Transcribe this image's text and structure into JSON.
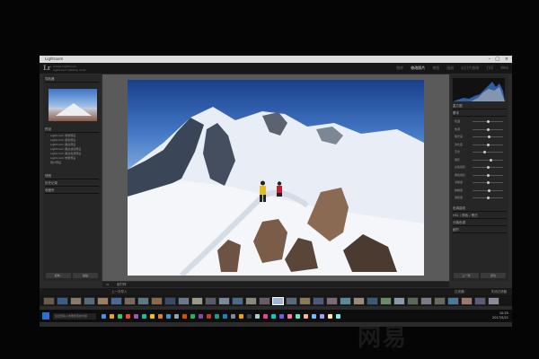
{
  "window": {
    "title": "Lightroom",
    "controls": [
      "–",
      "□",
      "×"
    ]
  },
  "identity": {
    "logo": "Lr",
    "catalog_line1": "Adobe Lightroom",
    "catalog_line2": "Lightroom Catalog .lrcat"
  },
  "modules": [
    {
      "label": "图库",
      "active": false
    },
    {
      "label": "修改照片",
      "active": true
    },
    {
      "label": "地图",
      "active": false
    },
    {
      "label": "画册",
      "active": false
    },
    {
      "label": "幻灯片放映",
      "active": false
    },
    {
      "label": "打印",
      "active": false
    },
    {
      "label": "Web",
      "active": false
    }
  ],
  "left_panel": {
    "navigator_header": "导航器",
    "presets_header": "预设",
    "presets": [
      "Lightroom 常规预设",
      "Lightroom 颜色预设",
      "Lightroom 黑白预设",
      "Lightroom 黑白滤镜预设",
      "Lightroom 黑白色调预设",
      "Lightroom 效果预设",
      "用户预设"
    ],
    "snapshots_header": "快照",
    "history_header": "历史记录",
    "collections_header": "收藏夹",
    "copy_button": "复制...",
    "paste_button": "粘贴"
  },
  "right_panel": {
    "histogram_header": "直方图",
    "basic_header": "基本",
    "sliders": [
      {
        "label": "色温",
        "value": 0.5
      },
      {
        "label": "色调",
        "value": 0.5
      },
      {
        "label": "曝光度",
        "value": 0.55
      },
      {
        "label": "对比度",
        "value": 0.5
      },
      {
        "label": "高光",
        "value": 0.4
      },
      {
        "label": "阴影",
        "value": 0.6
      },
      {
        "label": "白色色阶",
        "value": 0.5
      },
      {
        "label": "黑色色阶",
        "value": 0.5
      },
      {
        "label": "清晰度",
        "value": 0.5
      },
      {
        "label": "鲜艳度",
        "value": 0.55
      },
      {
        "label": "饱和度",
        "value": 0.5
      }
    ],
    "tone_curve_header": "色调曲线",
    "hsl_header": "HSL / 颜色 / 黑白",
    "split_header": "分离色调",
    "detail_header": "细节",
    "previous_button": "上一张",
    "reset_button": "复位"
  },
  "toolbar": {
    "view_label": "▭",
    "softproof_label": "软打样"
  },
  "filmstrip_bar": {
    "source": "上一次导入",
    "filter": "过滤器：",
    "filter_value": "关闭过滤器"
  },
  "filmstrip_colors": [
    "#6a5a4a",
    "#3e5c8a",
    "#8a7a6a",
    "#556b7a",
    "#9a8060",
    "#4a6a9a",
    "#7a6a5a",
    "#5a7a8a",
    "#8a6a4a",
    "#3a4a6a",
    "#6a7a8a",
    "#9a9a8a",
    "#5a5a6a",
    "#7a8a9a",
    "#4a6a8a",
    "#8a8a7a",
    "#6a5a6a",
    "#a0b8d0",
    "#5a6a7a",
    "#8a7a5a",
    "#4a5a7a",
    "#7a6a7a",
    "#5a8a9a",
    "#9a8a7a",
    "#3a5a7a",
    "#6a8a6a",
    "#8a9aaa",
    "#5a6a5a",
    "#7a7a8a",
    "#6a6a5a",
    "#4a7a9a",
    "#9a7a6a",
    "#5a5a7a",
    "#8a8a9a",
    "#6a7a6a",
    "#7a5a5a",
    "#4a6a7a",
    "#8a6a7a",
    "#5a7a6a",
    "#9a9aaa",
    "#6a5a7a",
    "#7a8a7a",
    "#4a5a6a",
    "#8a7a8a",
    "#5a8a7a",
    "#9a8a9a",
    "#6a7a9a",
    "#7a6a8a",
    "#4a8a8a",
    "#8a5a6a",
    "#5a6a8a",
    "#9a7a8a",
    "#6a8a9a",
    "#7a9a8a",
    "#4a6a6a",
    "#8a9a8a",
    "#5a9a9a",
    "#9a6a7a",
    "#6a6a8a",
    "#7a7a9a",
    "#4a7a8a",
    "#8a8a8a",
    "#5a6a9a",
    "#9a8a8a",
    "#6a9a8a",
    "#7a8a8a",
    "#4a5a8a",
    "#8a7a9a",
    "#5a7a9a",
    "#9a9a9a",
    "#6a6a9a",
    "#7a9a9a",
    "#4a8a9a",
    "#8a6a8a",
    "#5a8a8a",
    "#9a7a9a",
    "#6a8a8a",
    "#7a7a7a",
    "#4a9a9a",
    "#8a8a9a"
  ],
  "selected_thumb": 17,
  "taskbar": {
    "search_placeholder": "在这里输入你要搜索的内容",
    "icon_colors": [
      "#4a90e2",
      "#f0a030",
      "#2ecc71",
      "#e74c3c",
      "#9b59b6",
      "#1abc9c",
      "#f1c40f",
      "#e67e22",
      "#3498db",
      "#95a5a6",
      "#d35400",
      "#27ae60",
      "#8e44ad",
      "#c0392b",
      "#16a085",
      "#2980b9",
      "#7f8c8d",
      "#f39c12",
      "#2c3e50",
      "#bdc3c7",
      "#e84393",
      "#00cec9",
      "#6c5ce7",
      "#fd79a8",
      "#55efc4",
      "#fab1a0",
      "#74b9ff",
      "#a29bfe",
      "#ffeaa7",
      "#81ecec"
    ],
    "time": "10:25",
    "date": "2017/5/21"
  },
  "watermark": "网易"
}
